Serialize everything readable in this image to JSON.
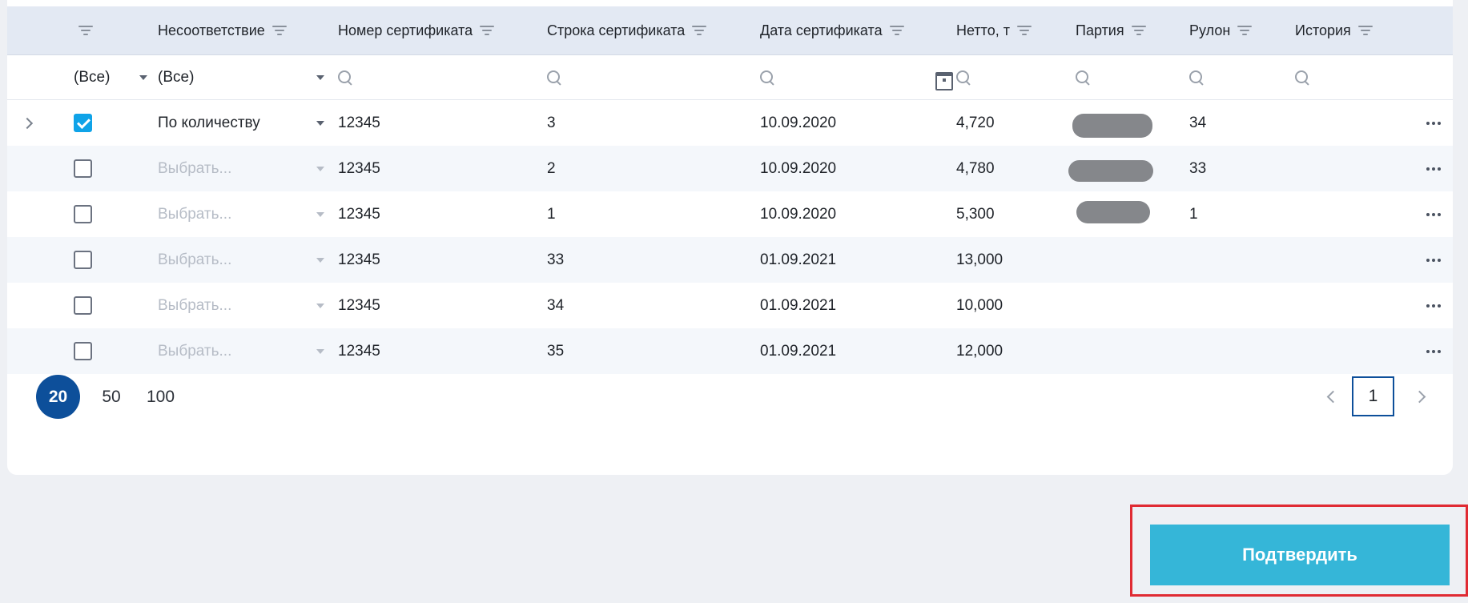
{
  "columns": {
    "nonconformity": "Несоответствие",
    "cert_number": "Номер сертификата",
    "cert_line": "Строка сертификата",
    "cert_date": "Дата сертификата",
    "netto": "Нетто, т",
    "batch": "Партия",
    "roll": "Рулон",
    "history": "История"
  },
  "filters": {
    "checkbox_filter": "(Все)",
    "nonconformity_filter": "(Все)"
  },
  "rows": [
    {
      "nonconformity": "По количеству",
      "placeholder": false,
      "checked": true,
      "cert_number": "12345",
      "cert_line": "3",
      "cert_date": "10.09.2020",
      "netto": "4,720",
      "roll": "34",
      "batch_redacted": true
    },
    {
      "nonconformity": "Выбрать...",
      "placeholder": true,
      "checked": false,
      "cert_number": "12345",
      "cert_line": "2",
      "cert_date": "10.09.2020",
      "netto": "4,780",
      "roll": "33",
      "batch_redacted": true
    },
    {
      "nonconformity": "Выбрать...",
      "placeholder": true,
      "checked": false,
      "cert_number": "12345",
      "cert_line": "1",
      "cert_date": "10.09.2020",
      "netto": "5,300",
      "roll": "1",
      "batch_redacted": true
    },
    {
      "nonconformity": "Выбрать...",
      "placeholder": true,
      "checked": false,
      "cert_number": "12345",
      "cert_line": "33",
      "cert_date": "01.09.2021",
      "netto": "13,000",
      "roll": "",
      "batch_redacted": false
    },
    {
      "nonconformity": "Выбрать...",
      "placeholder": true,
      "checked": false,
      "cert_number": "12345",
      "cert_line": "34",
      "cert_date": "01.09.2021",
      "netto": "10,000",
      "roll": "",
      "batch_redacted": false
    },
    {
      "nonconformity": "Выбрать...",
      "placeholder": true,
      "checked": false,
      "cert_number": "12345",
      "cert_line": "35",
      "cert_date": "01.09.2021",
      "netto": "12,000",
      "roll": "",
      "batch_redacted": false
    }
  ],
  "pager": {
    "sizes": [
      "20",
      "50",
      "100"
    ],
    "active_size": "20",
    "current_page": "1"
  },
  "actions": {
    "confirm_label": "Подтвердить"
  },
  "colors": {
    "header_bg": "#e3e9f3",
    "accent": "#0d4f9a",
    "checkbox_checked": "#0fa3e8",
    "confirm_button": "#35b6d8",
    "highlight_border": "#e02b33"
  }
}
